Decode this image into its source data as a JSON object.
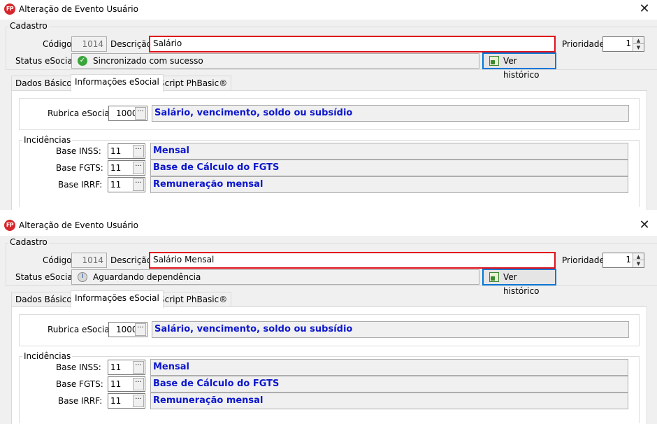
{
  "windows": [
    {
      "title": "Alteração de Evento Usuário",
      "app_icon_text": "FP",
      "close_glyph": "✕",
      "cadastro": {
        "group_label": "Cadastro",
        "codigo_label": "Código",
        "codigo_value": "1014",
        "descricao_label": "Descrição",
        "descricao_value": "Salário",
        "prioridade_label": "Prioridade",
        "prioridade_value": "1",
        "status_label": "Status eSocial",
        "status_text": "Sincronizado com sucesso",
        "status_icon": "check-circle-icon",
        "historico_button": "Ver histórico"
      },
      "tabs": [
        "Dados Básicos",
        "Informações eSocial",
        "Script PhBasic®"
      ],
      "active_tab": 1,
      "rubrica": {
        "label": "Rubrica eSocial",
        "code": "1000",
        "description": "Salário, vencimento, soldo ou subsídio"
      },
      "incidencias": {
        "group_label": "Incidências",
        "rows": [
          {
            "label": "Base INSS:",
            "code": "11",
            "description": "Mensal"
          },
          {
            "label": "Base FGTS:",
            "code": "11",
            "description": "Base de Cálculo do FGTS"
          },
          {
            "label": "Base IRRF:",
            "code": "11",
            "description": "Remuneração mensal"
          }
        ]
      }
    },
    {
      "title": "Alteração de Evento Usuário",
      "app_icon_text": "FP",
      "close_glyph": "✕",
      "cadastro": {
        "group_label": "Cadastro",
        "codigo_label": "Código",
        "codigo_value": "1014",
        "descricao_label": "Descrição",
        "descricao_value": "Salário Mensal",
        "prioridade_label": "Prioridade",
        "prioridade_value": "1",
        "status_label": "Status eSocial",
        "status_text": "Aguardando dependência",
        "status_icon": "clock-icon",
        "historico_button": "Ver histórico"
      },
      "tabs": [
        "Dados Básicos",
        "Informações eSocial",
        "Script PhBasic®"
      ],
      "active_tab": 1,
      "rubrica": {
        "label": "Rubrica eSocial",
        "code": "1000",
        "description": "Salário, vencimento, soldo ou subsídio"
      },
      "incidencias": {
        "group_label": "Incidências",
        "rows": [
          {
            "label": "Base INSS:",
            "code": "11",
            "description": "Mensal"
          },
          {
            "label": "Base FGTS:",
            "code": "11",
            "description": "Base de Cálculo do FGTS"
          },
          {
            "label": "Base IRRF:",
            "code": "11",
            "description": "Remuneração mensal"
          }
        ]
      }
    }
  ],
  "colors": {
    "highlight_border": "#e0121b",
    "link_description": "#0b16cc",
    "focus_border": "#0078d7",
    "status_ok": "#3aa63a"
  }
}
